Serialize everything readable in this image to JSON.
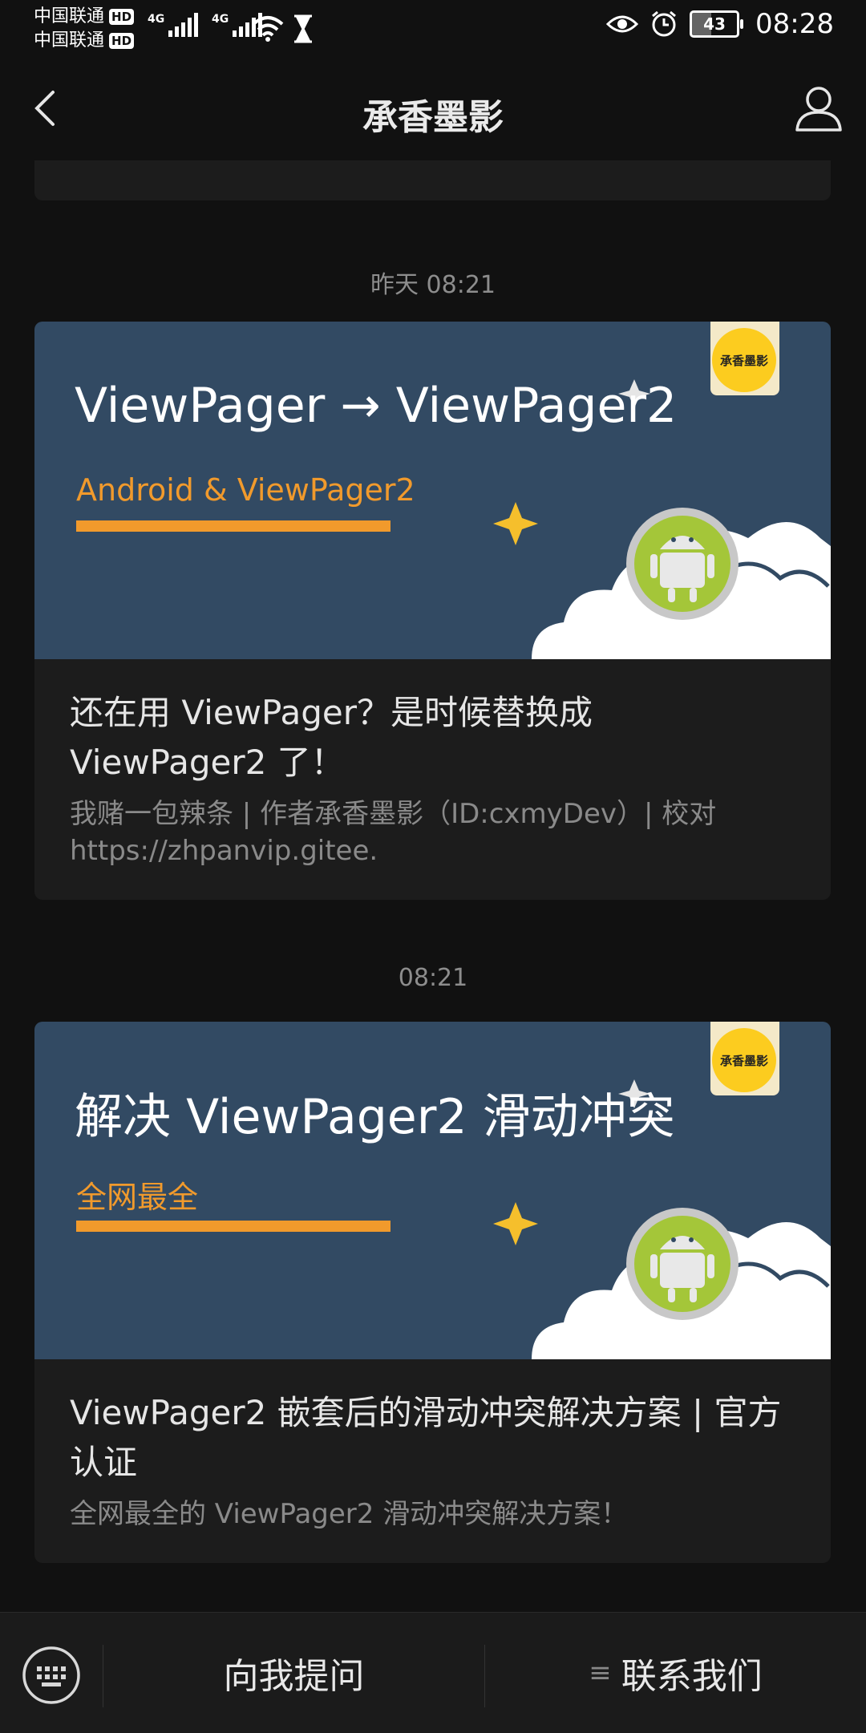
{
  "status_bar": {
    "carrier1": "中国联通",
    "carrier2": "中国联通",
    "hd": "HD",
    "network1": "4G",
    "network2": "4G",
    "battery_level": "43",
    "time": "08:28"
  },
  "nav": {
    "title": "承香墨影",
    "back_icon": "chevron-left-icon",
    "profile_icon": "person-icon"
  },
  "messages": [
    {
      "timestamp": "昨天 08:21",
      "cover": {
        "title": "ViewPager → ViewPager2",
        "subtitle": "Android & ViewPager2",
        "badge": "承香墨影"
      },
      "title": "还在用 ViewPager？是时候替换成 ViewPager2 了！",
      "description": "我赌一包辣条 | 作者承香墨影（ID:cxmyDev）| 校对 https://zhpanvip.gitee."
    },
    {
      "timestamp": "08:21",
      "cover": {
        "title": "解决 ViewPager2 滑动冲突",
        "subtitle": "全网最全",
        "badge": "承香墨影"
      },
      "title": "ViewPager2 嵌套后的滑动冲突解决方案 | 官方认证",
      "description": "全网最全的 ViewPager2 滑动冲突解决方案！"
    }
  ],
  "bottom_menu": {
    "keyboard_icon": "keyboard-icon",
    "item1": "向我提问",
    "item2": "联系我们",
    "item2_icon": "menu-lines-icon"
  },
  "colors": {
    "background": "#111111",
    "card": "#1c1c1c",
    "cover": "#324a63",
    "accent_orange": "#f19a2c",
    "badge_yellow": "#fccc1f"
  }
}
